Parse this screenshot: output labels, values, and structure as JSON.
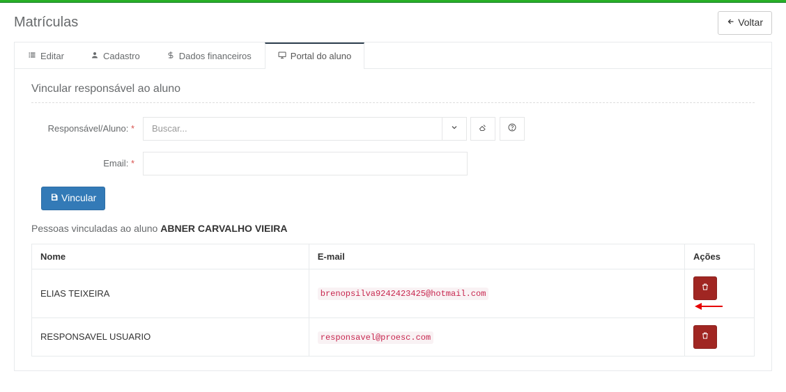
{
  "header": {
    "title": "Matrículas",
    "back_label": "Voltar"
  },
  "tabs": [
    {
      "icon": "list-icon",
      "label": "Editar"
    },
    {
      "icon": "user-icon",
      "label": "Cadastro"
    },
    {
      "icon": "dollar-icon",
      "label": "Dados financeiros"
    },
    {
      "icon": "monitor-icon",
      "label": "Portal do aluno",
      "active": true
    }
  ],
  "section": {
    "title": "Vincular responsável ao aluno",
    "responsavel_label": "Responsável/Aluno:",
    "responsavel_placeholder": "Buscar...",
    "email_label": "Email:",
    "link_button": "Vincular"
  },
  "linked": {
    "prefix": "Pessoas vinculadas ao aluno ",
    "student_name": "ABNER CARVALHO VIEIRA",
    "columns": {
      "name": "Nome",
      "email": "E-mail",
      "actions": "Ações"
    },
    "rows": [
      {
        "name": "ELIAS TEIXEIRA",
        "email": "brenopsilva9242423425@hotmail.com",
        "highlighted": true
      },
      {
        "name": "RESPONSAVEL USUARIO",
        "email": "responsavel@proesc.com",
        "highlighted": false
      }
    ]
  }
}
